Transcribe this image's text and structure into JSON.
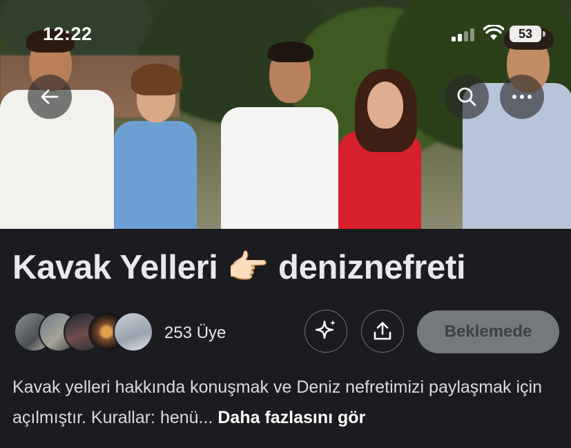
{
  "status_bar": {
    "time": "12:22",
    "battery": "53"
  },
  "community": {
    "title": "Kavak Yelleri 👉🏻 deniznefreti",
    "member_count_label": "253 Üye",
    "member_avatars": [
      "avatar-1",
      "avatar-2",
      "avatar-3",
      "avatar-4",
      "avatar-5"
    ],
    "join_status_label": "Beklemede",
    "description": "Kavak yelleri hakkında konuşmak ve Deniz nefretimizi paylaşmak için açılmıştır. Kurallar: henü...",
    "see_more_label": "Daha fazlasını gör"
  },
  "icons": {
    "back": "arrow-left-icon",
    "search": "search-icon",
    "more": "more-horizontal-icon",
    "ai": "sparkle-icon",
    "share": "share-icon"
  },
  "colors": {
    "background": "#1b1c20",
    "text": "#e7e9ea",
    "pending_button": "#75787c"
  }
}
